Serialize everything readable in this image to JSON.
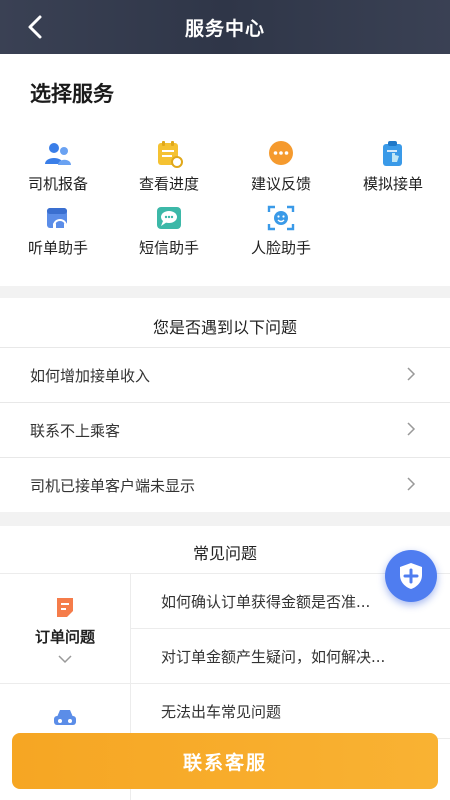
{
  "header": {
    "title": "服务中心",
    "back_icon": "chevron-left-icon"
  },
  "services": {
    "title": "选择服务",
    "items": [
      {
        "label": "司机报备",
        "icon": "driver-report-icon",
        "color": "#3a7ee8"
      },
      {
        "label": "查看进度",
        "icon": "progress-checklist-icon",
        "color": "#f5c232"
      },
      {
        "label": "建议反馈",
        "icon": "chat-bubble-icon",
        "color": "#f59a2e"
      },
      {
        "label": "模拟接单",
        "icon": "clipboard-touch-icon",
        "color": "#3a9ae8"
      },
      {
        "label": "听单助手",
        "icon": "headset-calendar-icon",
        "color": "#5b8de8"
      },
      {
        "label": "短信助手",
        "icon": "sms-message-icon",
        "color": "#3cb8a8"
      },
      {
        "label": "人脸助手",
        "icon": "face-scan-icon",
        "color": "#3a9ae8"
      }
    ]
  },
  "problems": {
    "title": "您是否遇到以下问题",
    "items": [
      {
        "text": "如何增加接单收入"
      },
      {
        "text": "联系不上乘客"
      },
      {
        "text": "司机已接单客户端未显示"
      }
    ]
  },
  "faq": {
    "title": "常见问题",
    "categories": [
      {
        "label": "订单问题",
        "icon": "document-icon",
        "color": "#f57c4a"
      },
      {
        "label": "",
        "icon": "car-icon",
        "color": "#5b8de8"
      }
    ],
    "questions": [
      {
        "text": "如何确认订单获得金额是否准..."
      },
      {
        "text": "对订单金额产生疑问，如何解决..."
      },
      {
        "text": "无法出车常见问题"
      }
    ]
  },
  "fab": {
    "icon": "shield-plus-icon",
    "color": "#4f7df0"
  },
  "contact_button": {
    "label": "联系客服",
    "color": "#f6a623"
  }
}
